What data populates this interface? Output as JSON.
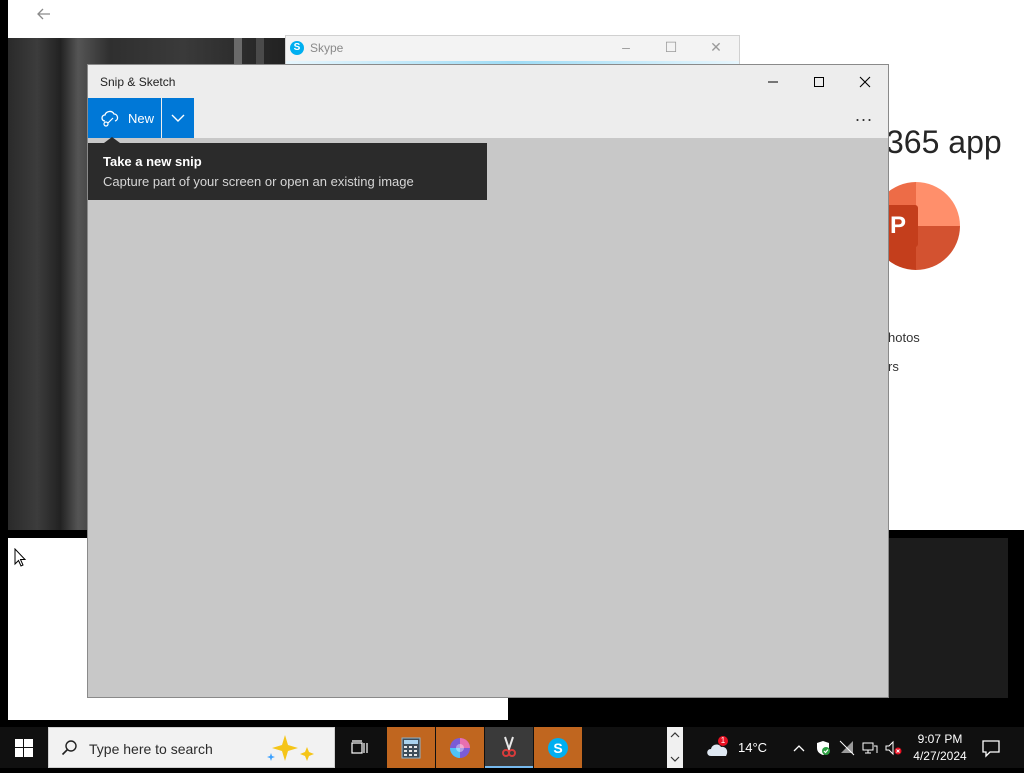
{
  "background": {
    "office": {
      "heading": "365 app",
      "line1": "hotos",
      "line2": "rs",
      "ppt_letter": "P"
    }
  },
  "skype_window": {
    "title": "Skype"
  },
  "snip_window": {
    "title": "Snip & Sketch",
    "new_label": "New",
    "tooltip": {
      "title": "Take a new snip",
      "description": "Capture part of your screen or open an existing image"
    },
    "more_label": "..."
  },
  "taskbar": {
    "search_placeholder": "Type here to search",
    "weather_temp": "14°C",
    "weather_badge": "1",
    "clock_time": "9:07 PM",
    "clock_date": "4/27/2024"
  },
  "colors": {
    "accent": "#0078d7",
    "taskbar_highlight": "#c0661f",
    "canvas": "#c8c8c8"
  }
}
